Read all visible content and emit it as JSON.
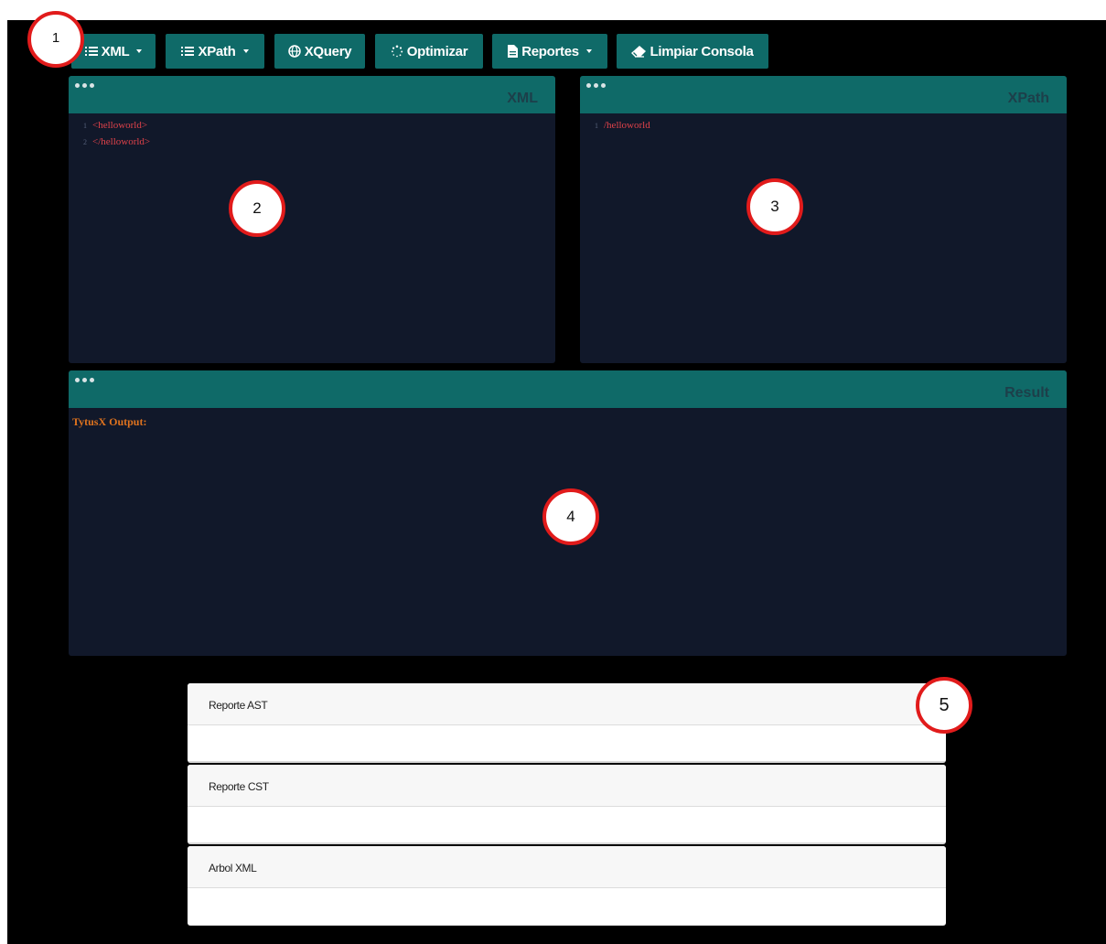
{
  "toolbar": {
    "xml_label": "XML",
    "xpath_label": "XPath",
    "xquery_label": "XQuery",
    "optimizar_label": "Optimizar",
    "reportes_label": "Reportes",
    "limpiar_label": "Limpiar Consola",
    "icons": {
      "xml": "list-icon",
      "xpath": "list-icon",
      "xquery": "globe-icon",
      "optimizar": "spinner-icon",
      "reportes": "file-icon",
      "limpiar": "eraser-icon"
    }
  },
  "panels": {
    "xml": {
      "title": "XML",
      "lines": [
        {
          "number": "1",
          "text": "<helloworld>"
        },
        {
          "number": "2",
          "text": "</helloworld>"
        }
      ]
    },
    "xpath": {
      "title": "XPath",
      "lines": [
        {
          "number": "1",
          "text": "/helloworld"
        }
      ]
    },
    "result": {
      "title": "Result",
      "output_label": "TytusX Output:"
    }
  },
  "reports": [
    {
      "label": "Reporte AST"
    },
    {
      "label": "Reporte CST"
    },
    {
      "label": "Arbol XML"
    }
  ],
  "callouts": [
    "1",
    "2",
    "3",
    "4",
    "5"
  ],
  "colors": {
    "accent": "#0f6a68",
    "panel_bg": "#11182a",
    "code_text": "#e0424a",
    "output_text": "#e0731e",
    "callout_border": "#e11b1b"
  }
}
